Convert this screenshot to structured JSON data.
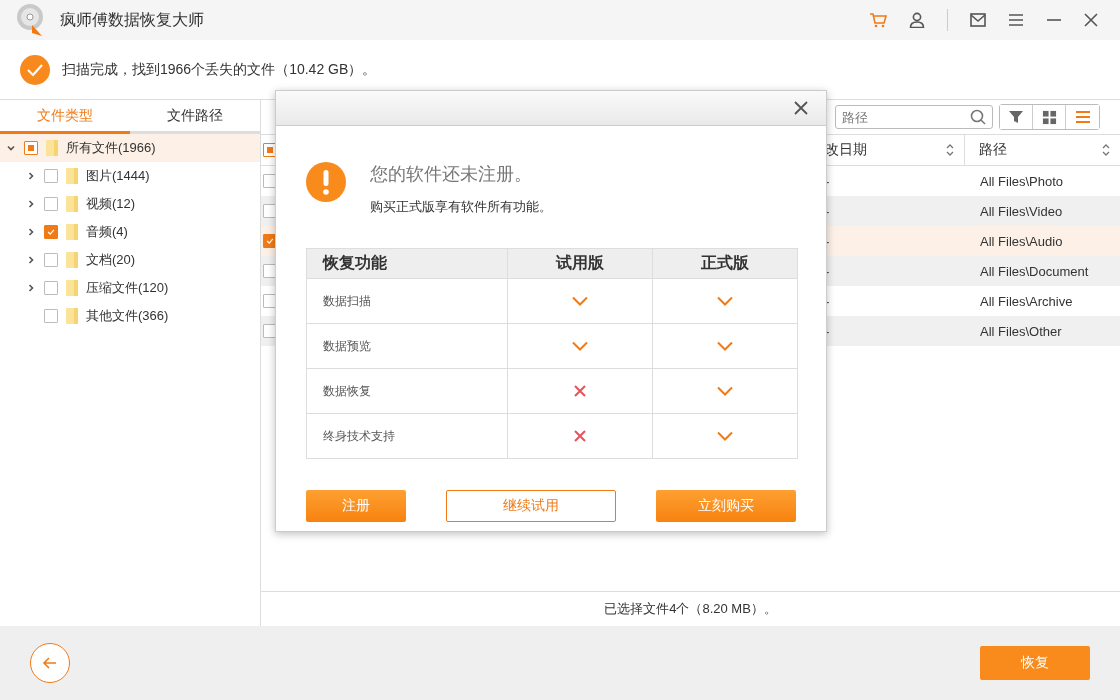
{
  "window": {
    "title": "疯师傅数据恢复大师"
  },
  "scan_status": {
    "text": "扫描完成，找到1966个丢失的文件（10.42 GB）。"
  },
  "tabs": [
    {
      "label": "文件类型",
      "selected": true
    },
    {
      "label": "文件路径",
      "selected": false
    }
  ],
  "tree": [
    {
      "label": "所有文件(1966)",
      "partial": true,
      "expanded": true,
      "selected": true,
      "children": [
        {
          "label": "图片(1444)",
          "checked": false,
          "expanded": false,
          "selected": false
        },
        {
          "label": "视频(12)",
          "checked": false,
          "expanded": false,
          "selected": false
        },
        {
          "label": "音频(4)",
          "checked": true,
          "expanded": false,
          "selected": false
        },
        {
          "label": "文档(20)",
          "checked": false,
          "expanded": false,
          "selected": false
        },
        {
          "label": "压缩文件(120)",
          "checked": false,
          "expanded": false,
          "selected": false
        },
        {
          "label": "其他文件(366)",
          "checked": false,
          "selected": false
        }
      ]
    }
  ],
  "search": {
    "placeholder": "路径"
  },
  "view_buttons": [
    {
      "kind": "filter",
      "selected": false
    },
    {
      "kind": "grid",
      "selected": false
    },
    {
      "kind": "list",
      "selected": true
    }
  ],
  "table": {
    "header_partial": true,
    "columns": [
      "改日期",
      "路径"
    ],
    "rows": [
      {
        "checked": false,
        "selected": false,
        "date": "-",
        "path": "All Files\\Photo"
      },
      {
        "checked": false,
        "selected": false,
        "date": "-",
        "path": "All Files\\Video"
      },
      {
        "checked": true,
        "selected": true,
        "date": "-",
        "path": "All Files\\Audio"
      },
      {
        "checked": false,
        "selected": false,
        "date": "-",
        "path": "All Files\\Document"
      },
      {
        "checked": false,
        "selected": false,
        "date": "-",
        "path": "All Files\\Archive"
      },
      {
        "checked": false,
        "selected": false,
        "date": "-",
        "path": "All Files\\Other"
      }
    ]
  },
  "selection_status": "已选择文件4个（8.20 MB）。",
  "recover_button": "恢复",
  "dialog": {
    "title": "您的软件还未注册。",
    "message": "购买正式版享有软件所有功能。",
    "columns": [
      "恢复功能",
      "试用版",
      "正式版"
    ],
    "rows": [
      {
        "feature": "数据扫描",
        "trial": true,
        "full": true
      },
      {
        "feature": "数据预览",
        "trial": true,
        "full": true
      },
      {
        "feature": "数据恢复",
        "trial": false,
        "full": true
      },
      {
        "feature": "终身技术支持",
        "trial": false,
        "full": true
      }
    ],
    "buttons": [
      {
        "label": "注册",
        "kind": "primary"
      },
      {
        "label": "继续试用",
        "kind": "outline"
      },
      {
        "label": "立刻购买",
        "kind": "primary"
      }
    ]
  }
}
